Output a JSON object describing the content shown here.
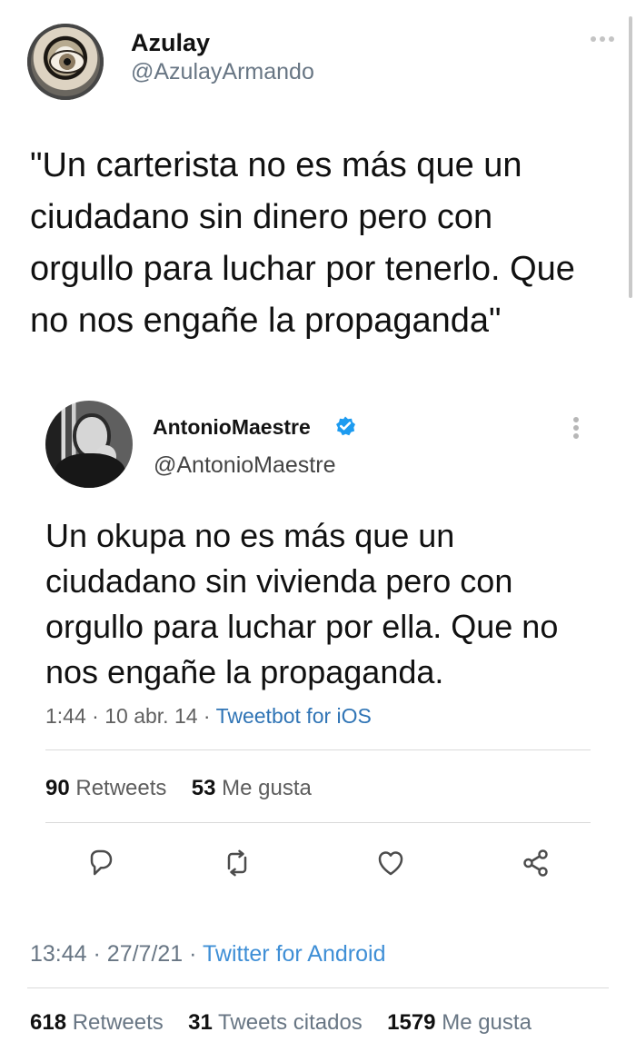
{
  "tweet": {
    "display_name": "Azulay",
    "username": "@AzulayArmando",
    "text": "\"Un carterista no es más que un ciudadano sin dinero pero con orgullo para luchar por tenerlo. Que no nos engañe la propaganda\"",
    "time": "13:44",
    "date": "27/7/21",
    "client": "Twitter for Android",
    "retweets_count": "618",
    "retweets_label": "Retweets",
    "quote_count": "31",
    "quote_label": "Tweets citados",
    "likes_count": "1579",
    "likes_label": "Me gusta"
  },
  "quoted_tweet": {
    "display_name": "AntonioMaestre",
    "username": "@AntonioMaestre",
    "text": "Un okupa no es más que un ciudadano sin vivienda pero con orgullo para luchar por ella. Que no nos engañe la propaganda.",
    "time": "1:44",
    "date": "10 abr. 14",
    "client": "Tweetbot for iOS",
    "retweets_count": "90",
    "retweets_label": "Retweets",
    "likes_count": "53",
    "likes_label": "Me gusta"
  },
  "separators": {
    "dot": "·"
  },
  "icons": {
    "verified": "verified-badge-icon",
    "reply": "reply-icon",
    "retweet": "retweet-icon",
    "like": "heart-icon",
    "share": "share-icon",
    "more": "more-icon"
  },
  "colors": {
    "link_blue": "#3f8fd6",
    "secondary_gray": "#687684",
    "verified_blue": "#1d9bf0"
  }
}
